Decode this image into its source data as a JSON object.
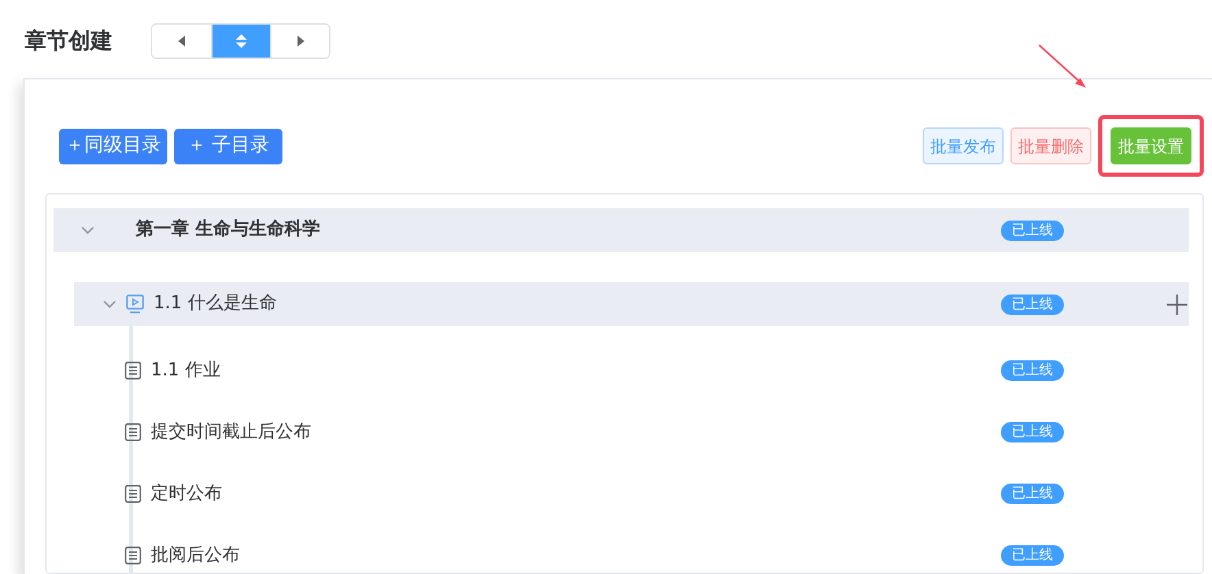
{
  "page_title": "章节创建",
  "view_switch": [
    {
      "kind": "left",
      "selected": false
    },
    {
      "kind": "updown",
      "selected": true
    },
    {
      "kind": "right",
      "selected": false
    }
  ],
  "left_buttons": [
    {
      "label": "＋同级目录"
    },
    {
      "label": "＋ 子目录"
    }
  ],
  "right_buttons": [
    {
      "label": "批量发布",
      "kind": "publish",
      "highlighted": false
    },
    {
      "label": "批量删除",
      "kind": "delete",
      "highlighted": false
    },
    {
      "label": "批量设置",
      "kind": "settings",
      "highlighted": true
    }
  ],
  "tree": [
    {
      "title": "第一章 生命与生命科学",
      "badge": "已上线",
      "expanded": true,
      "children": [
        {
          "title": "1.1 什么是生命",
          "kind": "video",
          "badge": "已上线",
          "expanded": true,
          "hovered": true,
          "children": [
            {
              "title": "1.1 作业",
              "kind": "document",
              "badge": "已上线"
            },
            {
              "title": "提交时间截止后公布",
              "kind": "document",
              "badge": "已上线"
            },
            {
              "title": "定时公布",
              "kind": "document",
              "badge": "已上线"
            },
            {
              "title": "批阅后公布",
              "kind": "document",
              "badge": "已上线"
            }
          ]
        }
      ]
    }
  ]
}
